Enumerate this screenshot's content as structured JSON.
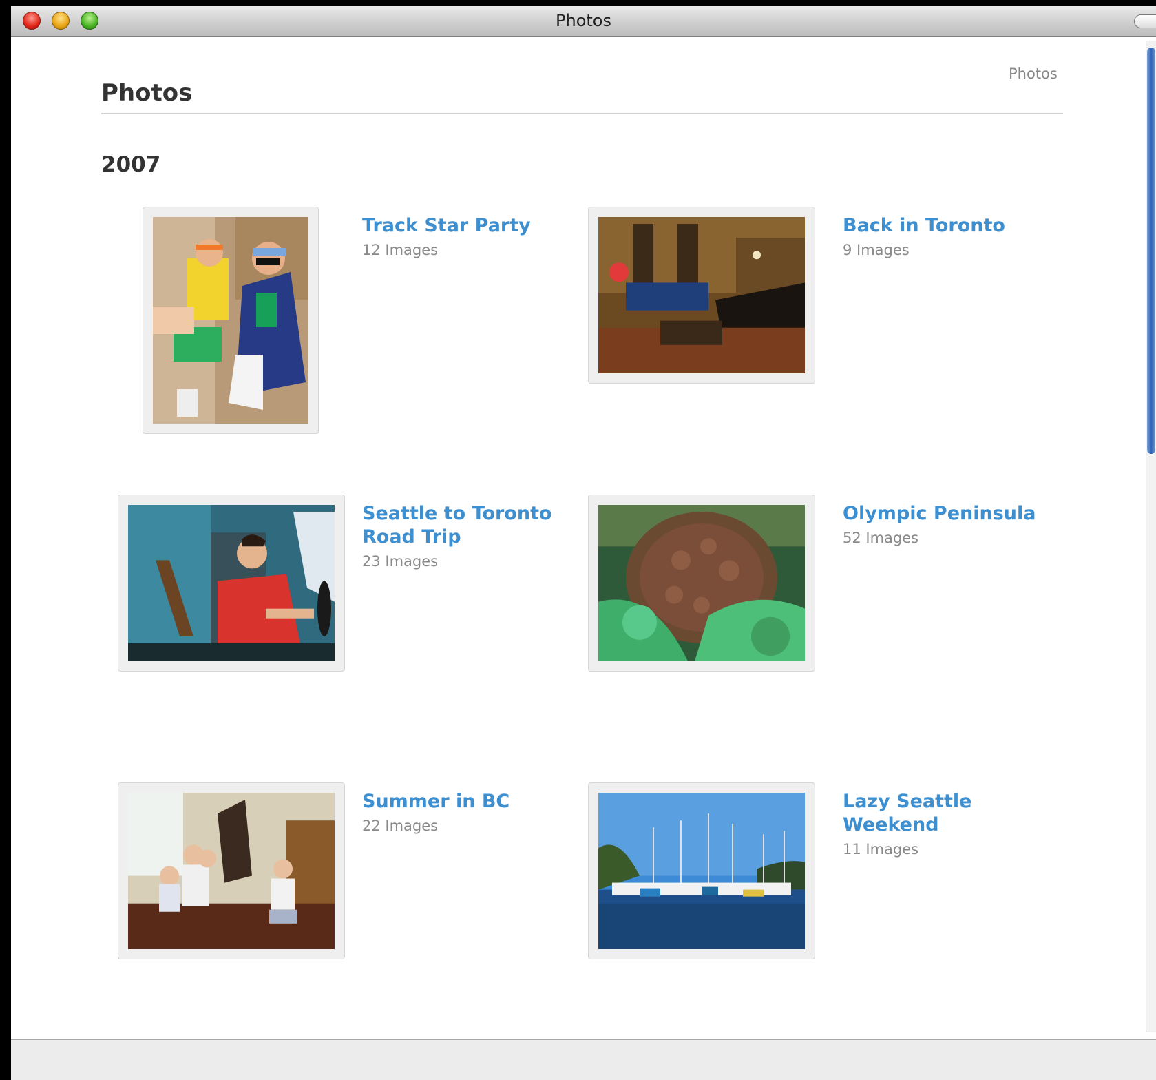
{
  "window": {
    "title": "Photos"
  },
  "breadcrumb": "Photos",
  "page_title": "Photos",
  "year": "2007",
  "albums": [
    {
      "title": "Track Star Party",
      "count": "12 Images"
    },
    {
      "title": "Back in Toronto",
      "count": "9 Images"
    },
    {
      "title": "Seattle to Toronto Road Trip",
      "count": "23 Images"
    },
    {
      "title": "Olympic Peninsula",
      "count": "52 Images"
    },
    {
      "title": "Summer in BC",
      "count": "22 Images"
    },
    {
      "title": "Lazy Seattle Weekend",
      "count": "11 Images"
    }
  ],
  "colors": {
    "link": "#3d8fd0",
    "count": "#8a8a8a",
    "heading": "#333333"
  }
}
